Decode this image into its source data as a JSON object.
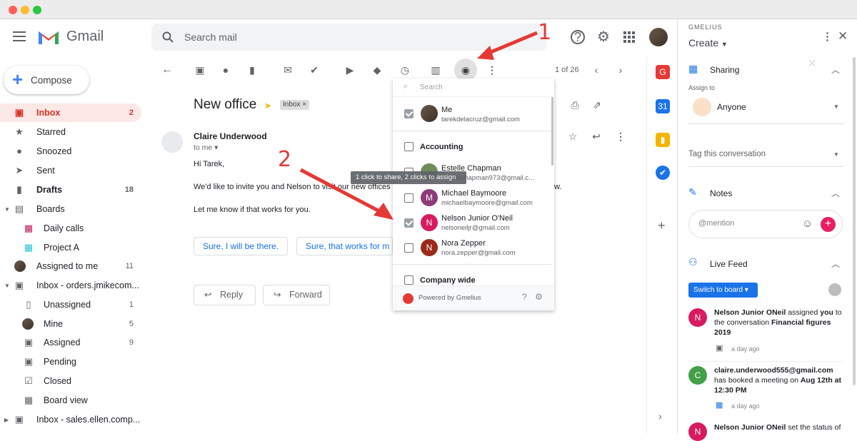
{
  "search": {
    "placeholder": "Search mail"
  },
  "app": {
    "logo_text": "Gmail"
  },
  "compose": {
    "label": "Compose"
  },
  "sidebar": {
    "items": [
      {
        "label": "Inbox",
        "count": "2"
      },
      {
        "label": "Starred",
        "count": ""
      },
      {
        "label": "Snoozed",
        "count": ""
      },
      {
        "label": "Sent",
        "count": ""
      },
      {
        "label": "Drafts",
        "count": "18"
      },
      {
        "label": "Boards",
        "count": ""
      },
      {
        "label": "Daily calls",
        "count": ""
      },
      {
        "label": "Project A",
        "count": ""
      },
      {
        "label": "Assigned to me",
        "count": "11"
      },
      {
        "label": "Inbox - orders.jmikecom...",
        "count": ""
      },
      {
        "label": "Unassigned",
        "count": "1"
      },
      {
        "label": "Mine",
        "count": "5"
      },
      {
        "label": "Assigned",
        "count": "9"
      },
      {
        "label": "Pending",
        "count": ""
      },
      {
        "label": "Closed",
        "count": ""
      },
      {
        "label": "Board view",
        "count": ""
      },
      {
        "label": "Inbox - sales.ellen.comp...",
        "count": ""
      }
    ]
  },
  "toolbar": {
    "pagination": "1 of 26"
  },
  "email": {
    "subject": "New office",
    "label_chip": "Inbox",
    "sender": "Claire Underwood",
    "to": "to me",
    "greeting": "Hi Tarek,",
    "line1": "We'd like to invite you and Nelson to visit our new offices l",
    "line1_tail": "w.",
    "line2": "Let me know if that works for you.",
    "smart_reply_1": "Sure, I will be there.",
    "smart_reply_2": "Sure, that works for m",
    "reply": "Reply",
    "forward": "Forward"
  },
  "popup": {
    "search_placeholder": "Search",
    "me_name": "Me",
    "me_email": "tarekdelacruz@gmail.com",
    "group1": "Accounting",
    "people": [
      {
        "name": "Estelle Chapman",
        "email": "estellechapman973@gmail.c...",
        "initial": "",
        "color": "#6d8c5a",
        "checked": false
      },
      {
        "name": "Michael Baymoore",
        "email": "michaelbaymoore@gmail.com",
        "initial": "M",
        "color": "#8e3a78",
        "checked": false
      },
      {
        "name": "Nelson Junior O'Neil",
        "email": "nelsoneiljr@gmail.com",
        "initial": "N",
        "color": "#d81b60",
        "checked": true
      },
      {
        "name": "Nora Zepper",
        "email": "nora.zepper@gmail.com",
        "initial": "N",
        "color": "#9c2a1a",
        "checked": false
      }
    ],
    "group2": "Company wide",
    "footer": "Powered by Gmelius",
    "tooltip": "1 click to share, 2 clicks to assign"
  },
  "annotations": {
    "arrow1": "1",
    "arrow2": "2"
  },
  "gmelius": {
    "brand": "GMELIUS",
    "create": "Create",
    "sharing": "Sharing",
    "assign_to": "Assign to",
    "assignee": "Anyone",
    "tag": "Tag this conversation",
    "notes": "Notes",
    "mention_placeholder": "@mention",
    "live_feed": "Live Feed",
    "switch_board": "Switch to board",
    "feed": [
      {
        "initial": "N",
        "color": "#d81b60",
        "text_bold1": "Nelson Junior ONeil",
        "text1": " assigned ",
        "text_bold2": "you",
        "text2": " to the conversation ",
        "text_bold3": "Financial figures 2019",
        "ago": "a day ago"
      },
      {
        "initial": "C",
        "color": "#43a047",
        "text_bold1": "claire.underwood555@gmail.com",
        "text1": " has booked a meeting on ",
        "text_bold2": "Aug 12th at 12:30 PM",
        "ago": "a day ago"
      },
      {
        "initial": "N",
        "color": "#d81b60",
        "text_bold1": "Nelson Junior ONeil",
        "text1": " set the status of"
      }
    ]
  }
}
